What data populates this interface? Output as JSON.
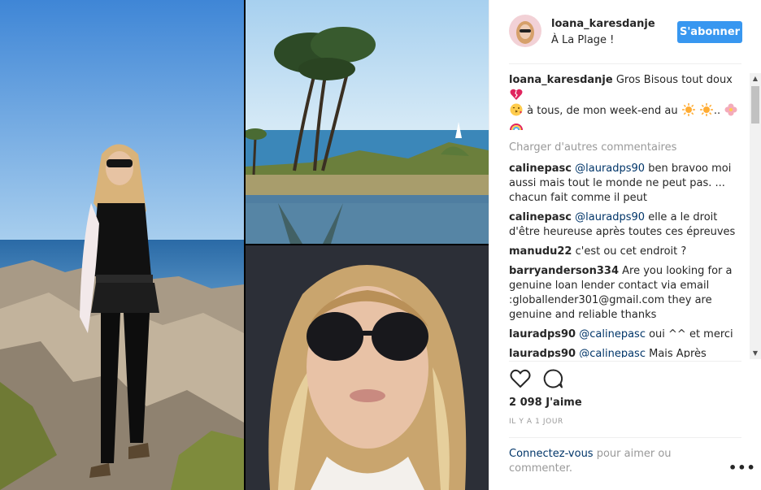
{
  "post": {
    "username": "loana_karesdanje",
    "location": "À La Plage !",
    "follow_label": "S'abonner",
    "caption": {
      "user": "loana_karesdanje",
      "text_1": " Gros Bisous tout doux ",
      "text_2": " à tous, de mon week-end au ",
      "text_3": ".. "
    },
    "load_more": "Charger d'autres commentaires",
    "comments": [
      {
        "user": "calinepasc",
        "mention": "@lauradps90",
        "text": " ben bravoo moi aussi mais tout le monde ne peut pas. ... chacun fait comme il peut"
      },
      {
        "user": "calinepasc",
        "mention": "@lauradps90",
        "text": " elle a le droit d'être heureuse après toutes ces épreuves"
      },
      {
        "user": "manudu22",
        "mention": "",
        "text": " c'est ou cet endroit ?"
      },
      {
        "user": "barryanderson334",
        "mention": "",
        "text": " Are you looking for a genuine loan lender contact via email :globallender301@gmail.com they are genuine and reliable thanks"
      },
      {
        "user": "lauradps90",
        "mention": "@calinepasc",
        "text": " oui ^^ et merci"
      },
      {
        "user": "lauradps90",
        "mention": "@calinepasc",
        "text": " Mais Après Comme Je Dit Si Je Pouvais Faire La Facilité"
      }
    ],
    "likes": "2 098 J'aime",
    "time_ago": "IL Y A 1 JOUR",
    "login_link": "Connectez-vous",
    "login_rest": " pour aimer ou commenter.",
    "more_label": "•••"
  },
  "icons": [
    "heart-icon",
    "comment-icon",
    "more-options-icon",
    "broken-heart-emoji",
    "kiss-emoji",
    "sun-emoji",
    "blossom-emoji",
    "rainbow-emoji"
  ],
  "colors": {
    "accent": "#3897f0",
    "link": "#003569",
    "muted": "#999999",
    "text": "#262626"
  }
}
